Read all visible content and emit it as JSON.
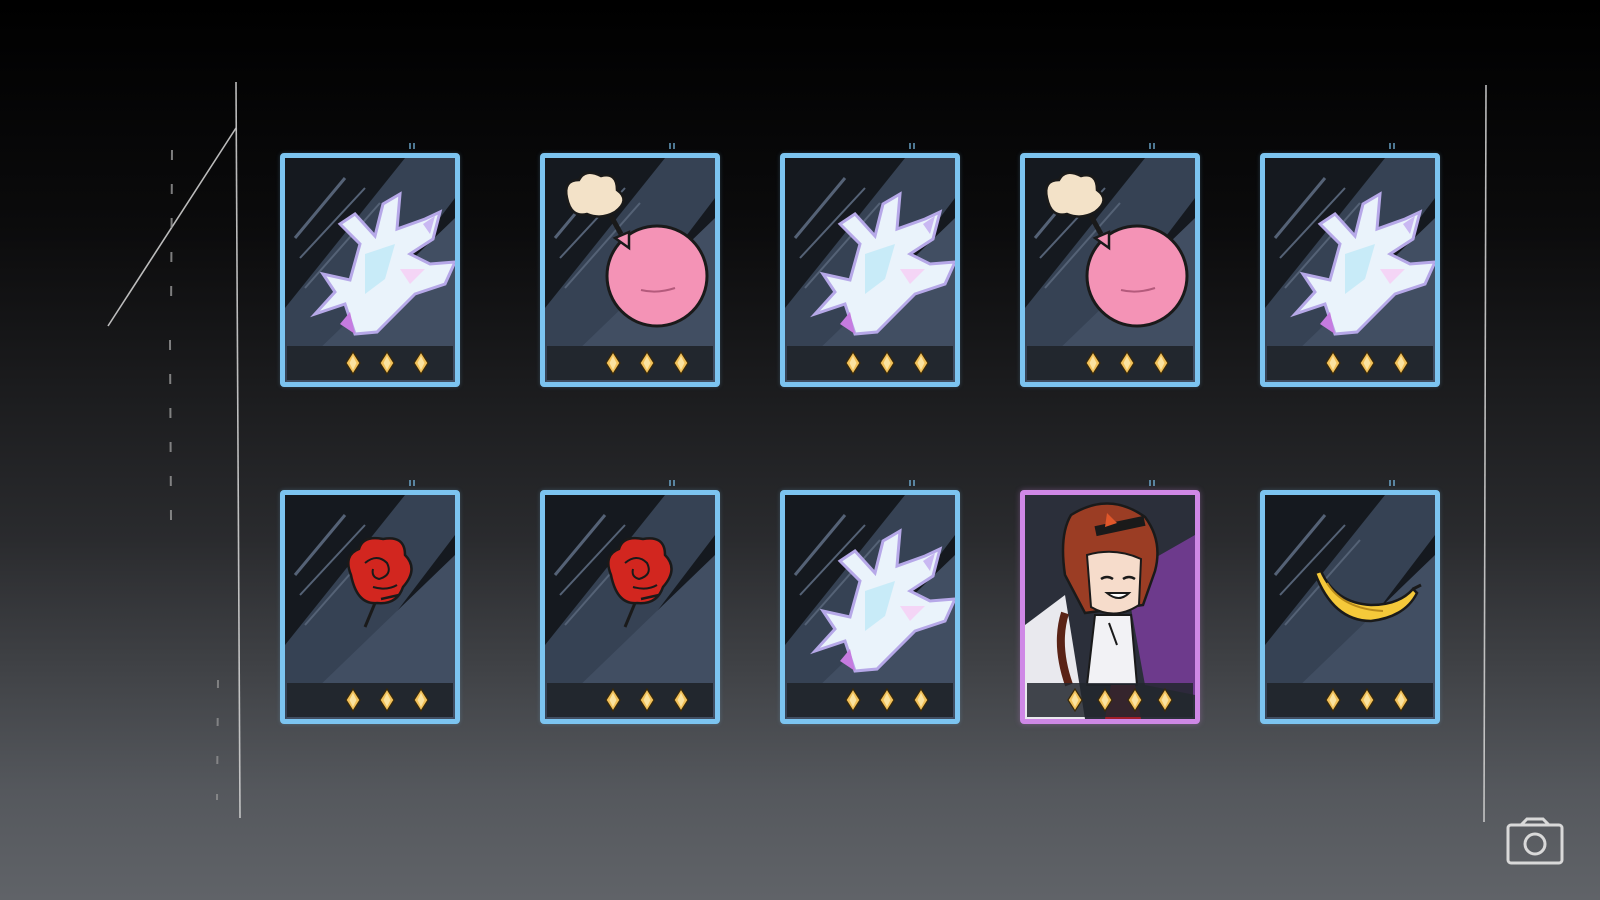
{
  "screen": "gacha-results",
  "colors": {
    "rare_border": "#7cc4f0",
    "epic_border": "#cf88e6",
    "star_color": "#f2c15a",
    "card_bg": "#15191f"
  },
  "cards": [
    {
      "item": "crystal-coral",
      "rarity": "rare",
      "stars": 3
    },
    {
      "item": "pink-bomb",
      "rarity": "rare",
      "stars": 3
    },
    {
      "item": "crystal-coral",
      "rarity": "rare",
      "stars": 3
    },
    {
      "item": "pink-bomb",
      "rarity": "rare",
      "stars": 3
    },
    {
      "item": "crystal-coral",
      "rarity": "rare",
      "stars": 3
    },
    {
      "item": "red-rose",
      "rarity": "rare",
      "stars": 3
    },
    {
      "item": "red-rose",
      "rarity": "rare",
      "stars": 3
    },
    {
      "item": "crystal-coral",
      "rarity": "rare",
      "stars": 3
    },
    {
      "item": "character-portrait",
      "rarity": "epic",
      "stars": 4
    },
    {
      "item": "banana",
      "rarity": "rare",
      "stars": 3
    }
  ],
  "toolbar": {
    "screenshot_icon": "camera-icon"
  }
}
